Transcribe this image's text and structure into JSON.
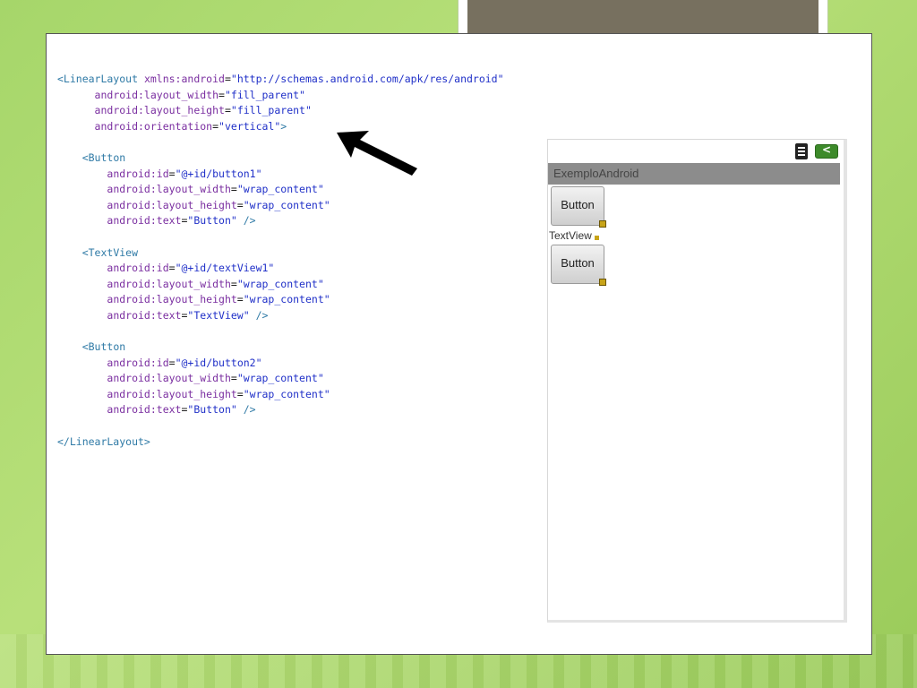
{
  "code_lines": [
    [
      {
        "c": "tag",
        "t": "<LinearLayout "
      },
      {
        "c": "attr",
        "t": "xmlns:android"
      },
      {
        "c": "plain",
        "t": "="
      },
      {
        "c": "val",
        "t": "\"http://schemas.android.com/apk/res/android\""
      }
    ],
    [
      {
        "c": "plain",
        "t": "      "
      },
      {
        "c": "attr",
        "t": "android:layout_width"
      },
      {
        "c": "plain",
        "t": "="
      },
      {
        "c": "val",
        "t": "\"fill_parent\""
      }
    ],
    [
      {
        "c": "plain",
        "t": "      "
      },
      {
        "c": "attr",
        "t": "android:layout_height"
      },
      {
        "c": "plain",
        "t": "="
      },
      {
        "c": "val",
        "t": "\"fill_parent\""
      }
    ],
    [
      {
        "c": "plain",
        "t": "      "
      },
      {
        "c": "attr",
        "t": "android:orientation"
      },
      {
        "c": "plain",
        "t": "="
      },
      {
        "c": "val",
        "t": "\"vertical\""
      },
      {
        "c": "tag",
        "t": ">"
      }
    ],
    [
      {
        "c": "plain",
        "t": ""
      }
    ],
    [
      {
        "c": "plain",
        "t": "    "
      },
      {
        "c": "tag",
        "t": "<Button"
      }
    ],
    [
      {
        "c": "plain",
        "t": "        "
      },
      {
        "c": "attr",
        "t": "android:id"
      },
      {
        "c": "plain",
        "t": "="
      },
      {
        "c": "val",
        "t": "\"@+id/button1\""
      }
    ],
    [
      {
        "c": "plain",
        "t": "        "
      },
      {
        "c": "attr",
        "t": "android:layout_width"
      },
      {
        "c": "plain",
        "t": "="
      },
      {
        "c": "val",
        "t": "\"wrap_content\""
      }
    ],
    [
      {
        "c": "plain",
        "t": "        "
      },
      {
        "c": "attr",
        "t": "android:layout_height"
      },
      {
        "c": "plain",
        "t": "="
      },
      {
        "c": "val",
        "t": "\"wrap_content\""
      }
    ],
    [
      {
        "c": "plain",
        "t": "        "
      },
      {
        "c": "attr",
        "t": "android:text"
      },
      {
        "c": "plain",
        "t": "="
      },
      {
        "c": "val",
        "t": "\"Button\""
      },
      {
        "c": "tag",
        "t": " />"
      }
    ],
    [
      {
        "c": "plain",
        "t": ""
      }
    ],
    [
      {
        "c": "plain",
        "t": "    "
      },
      {
        "c": "tag",
        "t": "<TextView"
      }
    ],
    [
      {
        "c": "plain",
        "t": "        "
      },
      {
        "c": "attr",
        "t": "android:id"
      },
      {
        "c": "plain",
        "t": "="
      },
      {
        "c": "val",
        "t": "\"@+id/textView1\""
      }
    ],
    [
      {
        "c": "plain",
        "t": "        "
      },
      {
        "c": "attr",
        "t": "android:layout_width"
      },
      {
        "c": "plain",
        "t": "="
      },
      {
        "c": "val",
        "t": "\"wrap_content\""
      }
    ],
    [
      {
        "c": "plain",
        "t": "        "
      },
      {
        "c": "attr",
        "t": "android:layout_height"
      },
      {
        "c": "plain",
        "t": "="
      },
      {
        "c": "val",
        "t": "\"wrap_content\""
      }
    ],
    [
      {
        "c": "plain",
        "t": "        "
      },
      {
        "c": "attr",
        "t": "android:text"
      },
      {
        "c": "plain",
        "t": "="
      },
      {
        "c": "val",
        "t": "\"TextView\""
      },
      {
        "c": "tag",
        "t": " />"
      }
    ],
    [
      {
        "c": "plain",
        "t": ""
      }
    ],
    [
      {
        "c": "plain",
        "t": "    "
      },
      {
        "c": "tag",
        "t": "<Button"
      }
    ],
    [
      {
        "c": "plain",
        "t": "        "
      },
      {
        "c": "attr",
        "t": "android:id"
      },
      {
        "c": "plain",
        "t": "="
      },
      {
        "c": "val",
        "t": "\"@+id/button2\""
      }
    ],
    [
      {
        "c": "plain",
        "t": "        "
      },
      {
        "c": "attr",
        "t": "android:layout_width"
      },
      {
        "c": "plain",
        "t": "="
      },
      {
        "c": "val",
        "t": "\"wrap_content\""
      }
    ],
    [
      {
        "c": "plain",
        "t": "        "
      },
      {
        "c": "attr",
        "t": "android:layout_height"
      },
      {
        "c": "plain",
        "t": "="
      },
      {
        "c": "val",
        "t": "\"wrap_content\""
      }
    ],
    [
      {
        "c": "plain",
        "t": "        "
      },
      {
        "c": "attr",
        "t": "android:text"
      },
      {
        "c": "plain",
        "t": "="
      },
      {
        "c": "val",
        "t": "\"Button\""
      },
      {
        "c": "tag",
        "t": " />"
      }
    ],
    [
      {
        "c": "plain",
        "t": ""
      }
    ],
    [
      {
        "c": "tag",
        "t": "</LinearLayout>"
      }
    ]
  ],
  "phone": {
    "title": "ExemploAndroid",
    "button1_label": "Button",
    "textview_label": "TextView",
    "button2_label": "Button",
    "status_icons": [
      "wifi-icon",
      "battery-icon"
    ]
  },
  "colors": {
    "background": "#a6d66a",
    "tag": "#2f7aa6",
    "attr": "#7a2ea0",
    "value": "#2030c8",
    "title_bar": "#8c8c8c"
  }
}
